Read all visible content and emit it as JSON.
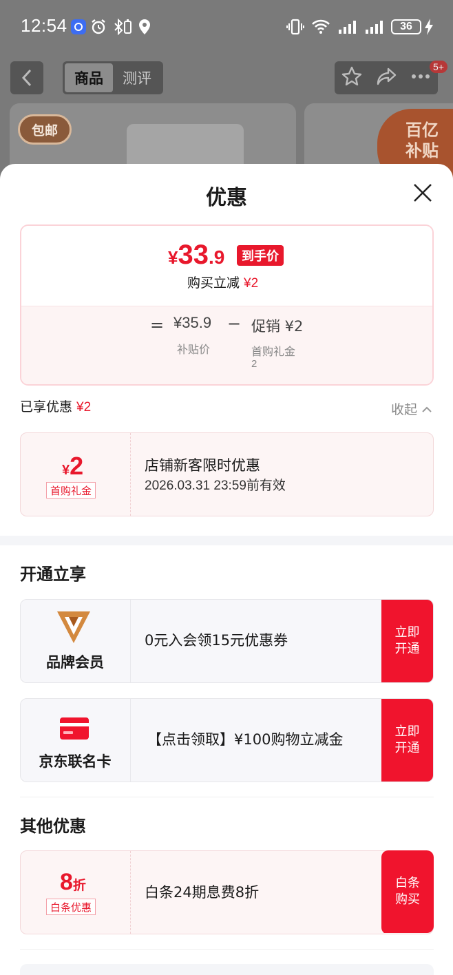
{
  "status_bar": {
    "time": "12:54",
    "battery": "36"
  },
  "background": {
    "tabs": [
      {
        "label": "商品"
      },
      {
        "label": "测评"
      }
    ],
    "message_badge": "5+",
    "card_tag": "包邮",
    "card_promo_line1": "百亿",
    "card_promo_line2": "补贴"
  },
  "sheet": {
    "title": "优惠",
    "price": {
      "currency": "¥",
      "integer": "33",
      "decimal": ".9",
      "tag": "到手价",
      "reduce_label": "购买立减",
      "reduce_amount": "¥2",
      "equals": "=",
      "subsidy_price": "¥35.9",
      "subsidy_label": "补贴价",
      "minus": "−",
      "promo_label": "促销 ¥2",
      "promo_item": "首购礼金",
      "promo_item_value": "2"
    },
    "enjoyed": {
      "label": "已享优惠",
      "amount": "¥2"
    },
    "collapse_label": "收起",
    "first_coupon": {
      "currency": "¥",
      "amount": "2",
      "tag": "首购礼金",
      "title": "店铺新客限时优惠",
      "validity": "2026.03.31 23:59前有效"
    },
    "open_section": {
      "title": "开通立享",
      "items": [
        {
          "name": "品牌会员",
          "text": "0元入会领15元优惠券",
          "button": "立即\n开通",
          "icon": "brand-v-icon"
        },
        {
          "name": "京东联名卡",
          "text": "【点击领取】¥100购物立减金",
          "button": "立即\n开通",
          "icon": "credit-card-icon"
        }
      ]
    },
    "other_section": {
      "title": "其他优惠",
      "baitiao": {
        "amount": "8",
        "unit": "折",
        "tag": "白条优惠",
        "text": "白条24期息费8折",
        "button": "白条\n购买"
      }
    }
  },
  "colors": {
    "accent": "#e8182c",
    "button": "#f0142d"
  }
}
